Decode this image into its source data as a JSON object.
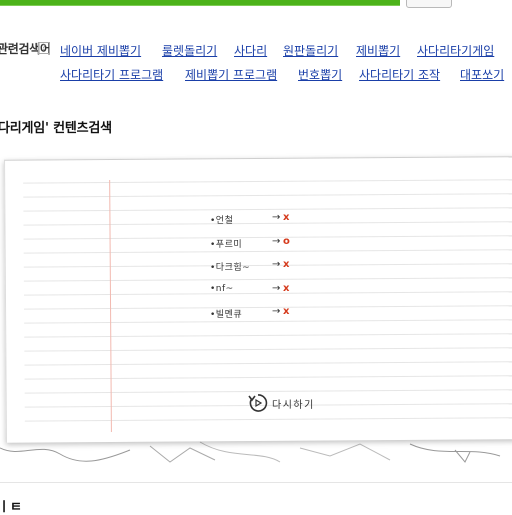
{
  "search_bar": {
    "button_label": ""
  },
  "related": {
    "label": "관련검색어",
    "help": "?",
    "keywords": [
      "네이버 제비뽑기",
      "룰렛돌리기",
      "사다리",
      "원판돌리기",
      "제비뽑기",
      "사다리타기게임",
      "사다리타기 프로그램",
      "제비뽑기 프로그램",
      "번호뽑기",
      "사다리타기 조작",
      "대포쏘기"
    ]
  },
  "section": {
    "title": "다리게임' 컨텐츠검색"
  },
  "game": {
    "entries": [
      {
        "name": "•언철",
        "arrow": "→",
        "result": "x"
      },
      {
        "name": "•푸르미",
        "arrow": "→",
        "result": "o"
      },
      {
        "name": "•다크힘~",
        "arrow": "→",
        "result": "x"
      },
      {
        "name": "•nf~",
        "arrow": "→",
        "result": "x"
      },
      {
        "name": "•빌멘큐",
        "arrow": "→",
        "result": "x"
      }
    ],
    "retry_label": "다시하기",
    "result_color": "#d53a1c"
  },
  "footer": {
    "title": "ㅣㅌ"
  },
  "colors": {
    "accent": "#4cb31a",
    "link": "#1a3fa8"
  }
}
